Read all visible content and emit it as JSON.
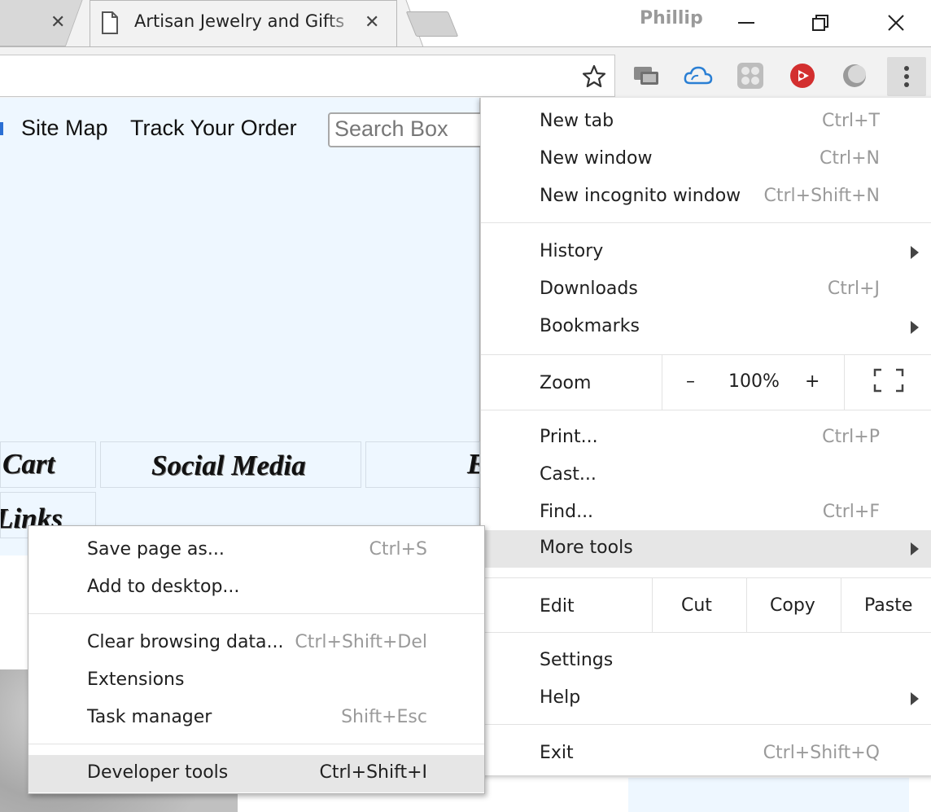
{
  "tabs": {
    "active_title": "Artisan Jewelry and Gifts",
    "close_glyph": "✕"
  },
  "profile": {
    "name": "Phillip"
  },
  "window_controls": {
    "minimize": "—",
    "restore": "❐",
    "close": "✕"
  },
  "page": {
    "nav_items": [
      "Site Map",
      "Track Your Order"
    ],
    "search_placeholder": "Search Box",
    "cells": {
      "cart": "Cart",
      "social": "Social Media",
      "partial": "E",
      "links": "Links"
    }
  },
  "main_menu": {
    "new_tab": {
      "label": "New tab",
      "shortcut": "Ctrl+T"
    },
    "new_window": {
      "label": "New window",
      "shortcut": "Ctrl+N"
    },
    "incognito": {
      "label": "New incognito window",
      "shortcut": "Ctrl+Shift+N"
    },
    "history": {
      "label": "History"
    },
    "downloads": {
      "label": "Downloads",
      "shortcut": "Ctrl+J"
    },
    "bookmarks": {
      "label": "Bookmarks"
    },
    "zoom": {
      "label": "Zoom",
      "minus": "–",
      "value": "100%",
      "plus": "+"
    },
    "print": {
      "label": "Print...",
      "shortcut": "Ctrl+P"
    },
    "cast": {
      "label": "Cast..."
    },
    "find": {
      "label": "Find...",
      "shortcut": "Ctrl+F"
    },
    "more_tools": {
      "label": "More tools"
    },
    "edit": {
      "label": "Edit",
      "cut": "Cut",
      "copy": "Copy",
      "paste": "Paste"
    },
    "settings": {
      "label": "Settings"
    },
    "help": {
      "label": "Help"
    },
    "exit": {
      "label": "Exit",
      "shortcut": "Ctrl+Shift+Q"
    }
  },
  "submenu": {
    "save_page": {
      "label": "Save page as...",
      "shortcut": "Ctrl+S"
    },
    "add_desktop": {
      "label": "Add to desktop..."
    },
    "clear_data": {
      "label": "Clear browsing data...",
      "shortcut": "Ctrl+Shift+Del"
    },
    "extensions": {
      "label": "Extensions"
    },
    "task_manager": {
      "label": "Task manager",
      "shortcut": "Shift+Esc"
    },
    "dev_tools": {
      "label": "Developer tools",
      "shortcut": "Ctrl+Shift+I"
    }
  },
  "colors": {
    "page_bg": "#eef7ff",
    "menu_highlight": "#e6e6e6",
    "shortcut_gray": "#9a9a9a"
  },
  "icons": [
    "page-icon",
    "tab-close-icon",
    "star-icon",
    "chat-icon",
    "cloud-icon",
    "dots-app-icon",
    "play-icon",
    "circle-icon",
    "menu-kebab-icon",
    "fullscreen-icon",
    "submenu-arrow-icon"
  ]
}
